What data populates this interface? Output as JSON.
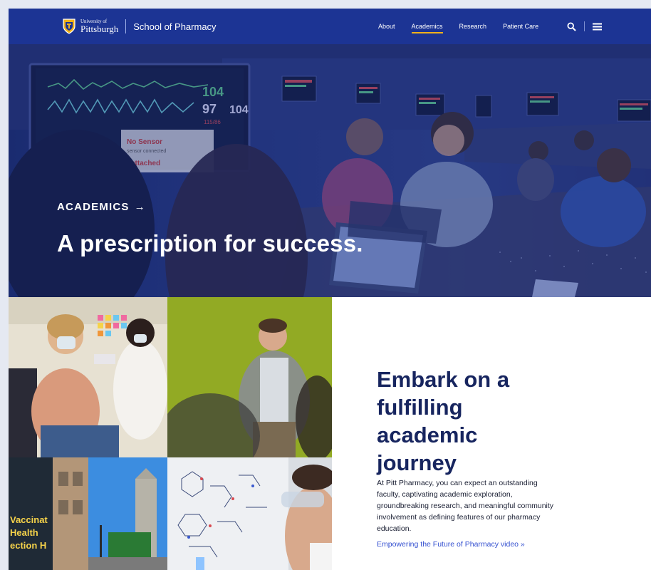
{
  "header": {
    "university_small": "University of",
    "university_big": "Pittsburgh",
    "school": "School of Pharmacy",
    "nav": [
      {
        "label": "About",
        "active": false
      },
      {
        "label": "Academics",
        "active": true
      },
      {
        "label": "Research",
        "active": false
      },
      {
        "label": "Patient Care",
        "active": false
      }
    ],
    "search_icon": "search-icon",
    "menu_icon": "menu-icon",
    "colors": {
      "header_bg": "#1c3494",
      "active_underline": "#f2b21a"
    }
  },
  "hero": {
    "eyebrow": "ACADEMICS",
    "eyebrow_arrow": "→",
    "headline": "A prescription for success.",
    "monitor_values": [
      "104",
      "97",
      "104",
      "115/86"
    ],
    "monitor_messages": [
      "No Sensor",
      "sensor connected",
      "attached"
    ]
  },
  "photos": {
    "sign_lines": [
      "Vaccinat",
      "Health",
      "ection H"
    ]
  },
  "content": {
    "title": "Embark on a fulfilling academic journey",
    "body": "At Pitt Pharmacy, you can expect an outstanding faculty, captivating academic exploration, groundbreaking research, and meaningful community involvement as defining features of our pharmacy education.",
    "link": "Empowering the Future of Pharmacy video »",
    "colors": {
      "title": "#17255f",
      "link": "#3450d0"
    }
  }
}
